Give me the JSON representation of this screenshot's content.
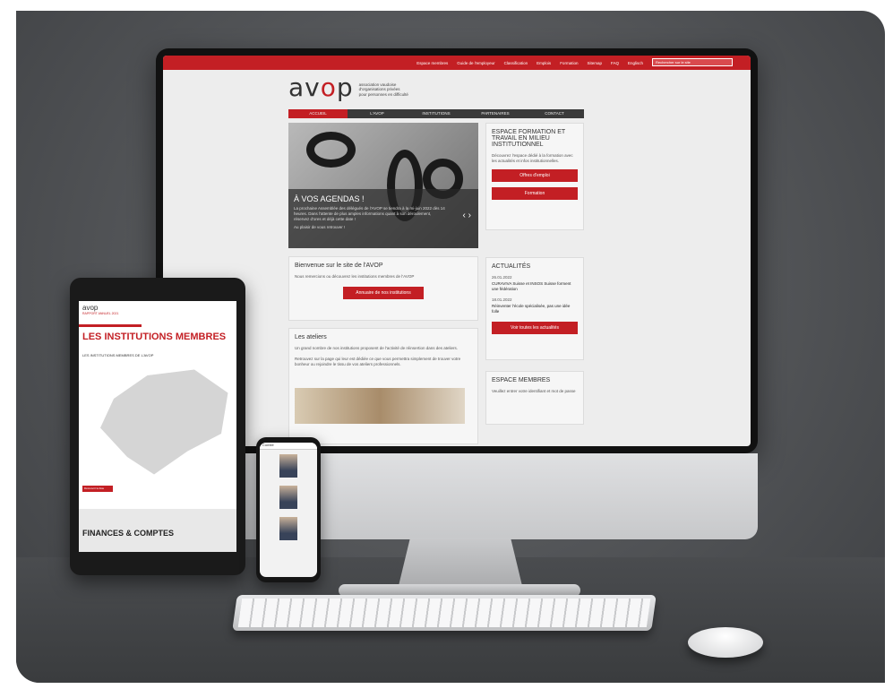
{
  "site": {
    "logo_prefix": "av",
    "logo_accent": "o",
    "logo_suffix": "p",
    "tagline_1": "association vaudoise",
    "tagline_2": "d'organisations privées",
    "tagline_3": "pour personnes en difficulté",
    "top_links": [
      "Espace membres",
      "Guide de l'employeur",
      "Classification",
      "Emplois",
      "Formation",
      "Sitemap",
      "FAQ",
      "Englisch"
    ],
    "search_placeholder": "Rechercher sur le site",
    "nav": [
      "ACCUEIL",
      "L'AVOP",
      "INSTITUTIONS",
      "PARTENAIRES",
      "CONTACT"
    ],
    "hero": {
      "title": "À VOS AGENDAS !",
      "text": "La prochaine Assemblée des délégués de l'AVOP se tiendra à la mi-juin 2022 dès 14 heures. Dans l'attente de plus amples informations quant à son déroulement, réservez d'ores et déjà cette date !",
      "footer": "Au plaisir de vous retrouver !"
    },
    "side_formation": {
      "title": "ESPACE FORMATION ET TRAVAIL EN MILIEU INSTITUTIONNEL",
      "text": "Découvrez l'espace dédié à la formation avec les actualités et infos institutionnelles.",
      "button_1": "Offres d'emploi",
      "button_2": "Formation"
    },
    "welcome": {
      "title": "Bienvenue sur le site de l'AVOP",
      "text": "Nous remercions ou découvrez les institutions membres de l'AVOP",
      "button": "Annuaire de nos institutions"
    },
    "actualites": {
      "title": "ACTUALITÉS",
      "item_1_date": "26.01.2022",
      "item_1": "CURAVIVA Suisse et INSOS Suisse forment une fédération",
      "item_2_date": "18.01.2022",
      "item_2": "Réinventer l'école spécialisée, pas une idée folle",
      "button": "Voir toutes les actualités"
    },
    "ateliers": {
      "title": "Les ateliers",
      "text_1": "Un grand nombre de nos institutions proposent de l'activité de réinsertion dans des ateliers.",
      "text_2": "Retrouvez sur la page qui leur est dédiée ce que vous permettra simplement de trouver votre bonheur ou rejoindre le tissu de vos ateliers professionnels."
    },
    "espace_membres": {
      "title": "ESPACE MEMBRES",
      "text": "Veuillez entrer votre identifiant et mot de passe"
    }
  },
  "tablet": {
    "logo": "avop",
    "report": "RAPPORT ANNUEL 2021",
    "title": "LES INSTITUTIONS MEMBRES",
    "subtitle": "LES INSTITUTIONS MEMBRES DE L'AVOP",
    "button": "Découvrir la liste",
    "footer": "FINANCES & COMPTES"
  },
  "phone": {
    "header": "Comité"
  }
}
